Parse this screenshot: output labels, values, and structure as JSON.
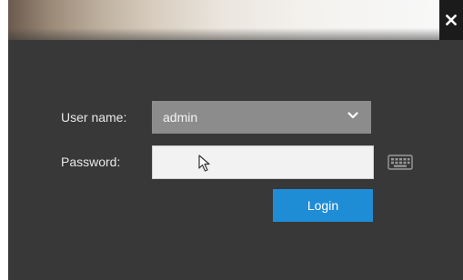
{
  "dialog": {
    "close_icon": "close-icon"
  },
  "login_form": {
    "username_label": "User name:",
    "username_value": "admin",
    "username_dropdown_icon": "chevron-down-icon",
    "password_label": "Password:",
    "password_value": "",
    "keyboard_icon": "keyboard-icon",
    "login_label": "Login"
  },
  "colors": {
    "dialog_background": "#383838",
    "select_background": "#8c8c8c",
    "input_background": "#f2f2f2",
    "accent": "#1f8cd6"
  }
}
